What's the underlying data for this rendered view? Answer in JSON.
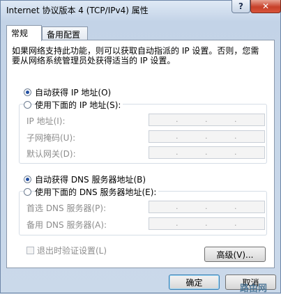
{
  "window": {
    "title": "Internet 协议版本 4 (TCP/IPv4) 属性",
    "help_label": "?",
    "close_label": "✕"
  },
  "tabs": [
    {
      "label": "常规",
      "active": true
    },
    {
      "label": "备用配置",
      "active": false
    }
  ],
  "description": "如果网络支持此功能，则可以获取自动指派的 IP 设置。否则，您需要从网络系统管理员处获得适当的 IP 设置。",
  "ip_section": {
    "auto_label": "自动获得 IP 地址(O)",
    "auto_selected": true,
    "manual_label": "使用下面的 IP 地址(S):",
    "manual_selected": false,
    "fields": [
      {
        "label": "IP 地址(I):",
        "value": ""
      },
      {
        "label": "子网掩码(U):",
        "value": ""
      },
      {
        "label": "默认网关(D):",
        "value": ""
      }
    ]
  },
  "dns_section": {
    "auto_label": "自动获得 DNS 服务器地址(B)",
    "auto_selected": true,
    "manual_label": "使用下面的 DNS 服务器地址(E):",
    "manual_selected": false,
    "fields": [
      {
        "label": "首选 DNS 服务器(P):",
        "value": ""
      },
      {
        "label": "备用 DNS 服务器(A):",
        "value": ""
      }
    ]
  },
  "validate_label": "退出时验证设置(L)",
  "validate_checked": false,
  "buttons": {
    "advanced": "高级(V)...",
    "ok": "确定",
    "cancel": "取消"
  },
  "watermark": "路由网"
}
